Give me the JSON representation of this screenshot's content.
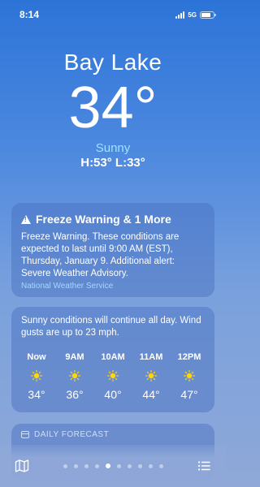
{
  "status": {
    "time": "8:14",
    "network": "5G"
  },
  "location": {
    "city": "Bay Lake",
    "temperature": "34°",
    "condition": "Sunny",
    "hi_lo": "H:53°  L:33°"
  },
  "alert": {
    "title": "Freeze Warning & 1 More",
    "body": "Freeze Warning. These conditions are expected to last until 9:00 AM (EST), Thursday, January 9. Additional alert: Severe Weather Advisory.",
    "source": "National Weather Service"
  },
  "hourly": {
    "description": "Sunny conditions will continue all day. Wind gusts are up to 23 mph.",
    "hours": [
      {
        "label": "Now",
        "temp": "34°",
        "icon": "sun-icon"
      },
      {
        "label": "9AM",
        "temp": "36°",
        "icon": "sun-icon"
      },
      {
        "label": "10AM",
        "temp": "40°",
        "icon": "sun-icon"
      },
      {
        "label": "11AM",
        "temp": "44°",
        "icon": "sun-icon"
      },
      {
        "label": "12PM",
        "temp": "47°",
        "icon": "sun-icon"
      }
    ]
  },
  "daily": {
    "header": "DAILY FORECAST"
  },
  "bottom": {
    "page_count": 10,
    "active_page": 5,
    "left_icon": "map-icon",
    "right_icon": "list-icon"
  },
  "colors": {
    "condition_text": "#9fe3ff",
    "sun": "#ffd60a"
  }
}
